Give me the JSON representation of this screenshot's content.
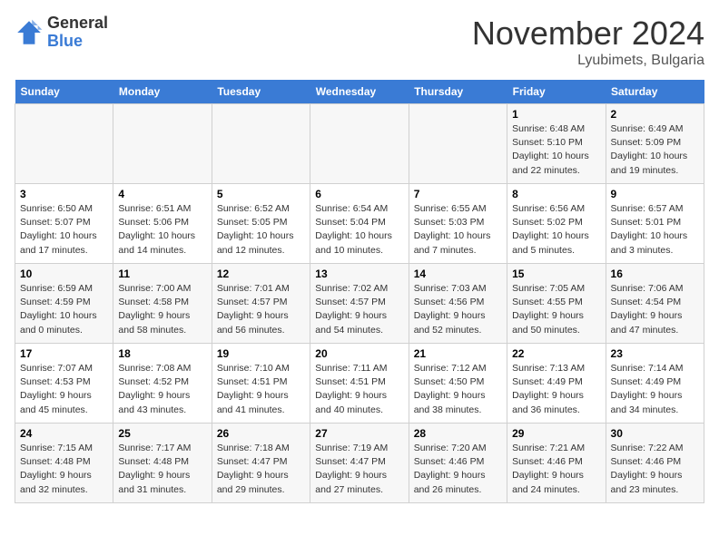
{
  "header": {
    "logo_general": "General",
    "logo_blue": "Blue",
    "month_title": "November 2024",
    "location": "Lyubimets, Bulgaria"
  },
  "weekdays": [
    "Sunday",
    "Monday",
    "Tuesday",
    "Wednesday",
    "Thursday",
    "Friday",
    "Saturday"
  ],
  "weeks": [
    [
      {
        "day": "",
        "info": ""
      },
      {
        "day": "",
        "info": ""
      },
      {
        "day": "",
        "info": ""
      },
      {
        "day": "",
        "info": ""
      },
      {
        "day": "",
        "info": ""
      },
      {
        "day": "1",
        "info": "Sunrise: 6:48 AM\nSunset: 5:10 PM\nDaylight: 10 hours and 22 minutes."
      },
      {
        "day": "2",
        "info": "Sunrise: 6:49 AM\nSunset: 5:09 PM\nDaylight: 10 hours and 19 minutes."
      }
    ],
    [
      {
        "day": "3",
        "info": "Sunrise: 6:50 AM\nSunset: 5:07 PM\nDaylight: 10 hours and 17 minutes."
      },
      {
        "day": "4",
        "info": "Sunrise: 6:51 AM\nSunset: 5:06 PM\nDaylight: 10 hours and 14 minutes."
      },
      {
        "day": "5",
        "info": "Sunrise: 6:52 AM\nSunset: 5:05 PM\nDaylight: 10 hours and 12 minutes."
      },
      {
        "day": "6",
        "info": "Sunrise: 6:54 AM\nSunset: 5:04 PM\nDaylight: 10 hours and 10 minutes."
      },
      {
        "day": "7",
        "info": "Sunrise: 6:55 AM\nSunset: 5:03 PM\nDaylight: 10 hours and 7 minutes."
      },
      {
        "day": "8",
        "info": "Sunrise: 6:56 AM\nSunset: 5:02 PM\nDaylight: 10 hours and 5 minutes."
      },
      {
        "day": "9",
        "info": "Sunrise: 6:57 AM\nSunset: 5:01 PM\nDaylight: 10 hours and 3 minutes."
      }
    ],
    [
      {
        "day": "10",
        "info": "Sunrise: 6:59 AM\nSunset: 4:59 PM\nDaylight: 10 hours and 0 minutes."
      },
      {
        "day": "11",
        "info": "Sunrise: 7:00 AM\nSunset: 4:58 PM\nDaylight: 9 hours and 58 minutes."
      },
      {
        "day": "12",
        "info": "Sunrise: 7:01 AM\nSunset: 4:57 PM\nDaylight: 9 hours and 56 minutes."
      },
      {
        "day": "13",
        "info": "Sunrise: 7:02 AM\nSunset: 4:57 PM\nDaylight: 9 hours and 54 minutes."
      },
      {
        "day": "14",
        "info": "Sunrise: 7:03 AM\nSunset: 4:56 PM\nDaylight: 9 hours and 52 minutes."
      },
      {
        "day": "15",
        "info": "Sunrise: 7:05 AM\nSunset: 4:55 PM\nDaylight: 9 hours and 50 minutes."
      },
      {
        "day": "16",
        "info": "Sunrise: 7:06 AM\nSunset: 4:54 PM\nDaylight: 9 hours and 47 minutes."
      }
    ],
    [
      {
        "day": "17",
        "info": "Sunrise: 7:07 AM\nSunset: 4:53 PM\nDaylight: 9 hours and 45 minutes."
      },
      {
        "day": "18",
        "info": "Sunrise: 7:08 AM\nSunset: 4:52 PM\nDaylight: 9 hours and 43 minutes."
      },
      {
        "day": "19",
        "info": "Sunrise: 7:10 AM\nSunset: 4:51 PM\nDaylight: 9 hours and 41 minutes."
      },
      {
        "day": "20",
        "info": "Sunrise: 7:11 AM\nSunset: 4:51 PM\nDaylight: 9 hours and 40 minutes."
      },
      {
        "day": "21",
        "info": "Sunrise: 7:12 AM\nSunset: 4:50 PM\nDaylight: 9 hours and 38 minutes."
      },
      {
        "day": "22",
        "info": "Sunrise: 7:13 AM\nSunset: 4:49 PM\nDaylight: 9 hours and 36 minutes."
      },
      {
        "day": "23",
        "info": "Sunrise: 7:14 AM\nSunset: 4:49 PM\nDaylight: 9 hours and 34 minutes."
      }
    ],
    [
      {
        "day": "24",
        "info": "Sunrise: 7:15 AM\nSunset: 4:48 PM\nDaylight: 9 hours and 32 minutes."
      },
      {
        "day": "25",
        "info": "Sunrise: 7:17 AM\nSunset: 4:48 PM\nDaylight: 9 hours and 31 minutes."
      },
      {
        "day": "26",
        "info": "Sunrise: 7:18 AM\nSunset: 4:47 PM\nDaylight: 9 hours and 29 minutes."
      },
      {
        "day": "27",
        "info": "Sunrise: 7:19 AM\nSunset: 4:47 PM\nDaylight: 9 hours and 27 minutes."
      },
      {
        "day": "28",
        "info": "Sunrise: 7:20 AM\nSunset: 4:46 PM\nDaylight: 9 hours and 26 minutes."
      },
      {
        "day": "29",
        "info": "Sunrise: 7:21 AM\nSunset: 4:46 PM\nDaylight: 9 hours and 24 minutes."
      },
      {
        "day": "30",
        "info": "Sunrise: 7:22 AM\nSunset: 4:46 PM\nDaylight: 9 hours and 23 minutes."
      }
    ]
  ]
}
